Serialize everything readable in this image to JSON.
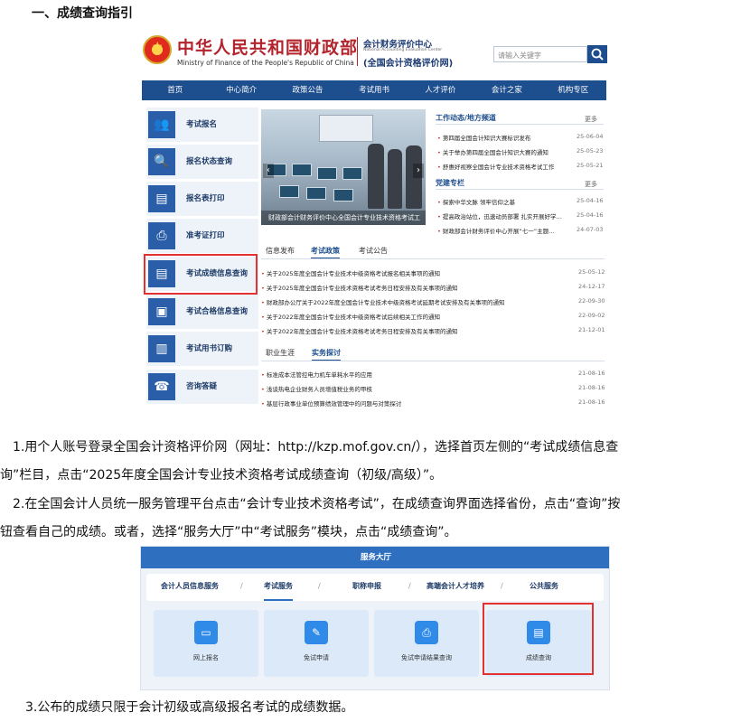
{
  "heading": "一、成绩查询指引",
  "shot1": {
    "ministry_cn": "中华人民共和国财政部",
    "ministry_en": "Ministry of Finance of the People's Republic of China",
    "center_cn": "会计财务评价中心",
    "center_en": "National Accounting Evaluation Center",
    "center_sub": "(全国会计资格评价网)",
    "search_placeholder": "请输入关键字",
    "nav": [
      "首页",
      "中心简介",
      "政策公告",
      "考试用书",
      "人才评价",
      "会计之家",
      "机构专区"
    ],
    "sidebar": [
      {
        "label": "考试报名",
        "icon": "users-icon"
      },
      {
        "label": "报名状态查询",
        "icon": "search-doc-icon"
      },
      {
        "label": "报名表打印",
        "icon": "form-print-icon"
      },
      {
        "label": "准考证打印",
        "icon": "printer-icon"
      },
      {
        "label": "考试成绩信息查询",
        "icon": "score-icon"
      },
      {
        "label": "考试合格信息查询",
        "icon": "certificate-icon"
      },
      {
        "label": "考试用书订购",
        "icon": "book-icon"
      },
      {
        "label": "咨询答疑",
        "icon": "support-icon"
      }
    ],
    "photo_caption": "财政部会计财务评价中心全国会计专业技术资格考试工作",
    "work_news": {
      "title": "工作动态/地方频道",
      "more": "更多",
      "items": [
        {
          "text": "第四届全国会计知识大赛标识发布",
          "date": "25-06-04"
        },
        {
          "text": "关于举办第四届全国会计知识大赛的通知",
          "date": "25-05-23"
        },
        {
          "text": "舒惠好视察全国会计专业技术资格考试工作",
          "date": "25-05-21"
        }
      ]
    },
    "party": {
      "title": "党建专栏",
      "more": "更多",
      "items": [
        {
          "text": "探索中华文脉  领牢信仰之基",
          "date": "25-04-16"
        },
        {
          "text": "提高政治站位，迅速动员部署 扎实开展好学…",
          "date": "25-04-16"
        },
        {
          "text": "财政部会计财务评价中心开展“七一”主题…",
          "date": "24-07-03"
        }
      ]
    },
    "tabs1": [
      "信息发布",
      "考试政策",
      "考试公告"
    ],
    "list1": [
      {
        "text": "关于2025年度全国会计专业技术中级资格考试报名相关事项的通知",
        "date": "25-05-12"
      },
      {
        "text": "关于2025年度全国会计专业技术资格考试考务日程安排及有关事项的通知",
        "date": "24-12-17"
      },
      {
        "text": "财政部办公厅关于2022年度全国会计专业技术中级资格考试延期考试安排及有关事项的通知",
        "date": "22-09-30"
      },
      {
        "text": "关于2022年度全国会计专业技术中级资格考试后续相关工作的通知",
        "date": "22-09-02"
      },
      {
        "text": "关于2022年度全国会计专业技术资格考试考务日程安排及有关事项的通知",
        "date": "21-12-01"
      }
    ],
    "tabs2": [
      "职业生涯",
      "实务探讨"
    ],
    "list2": [
      {
        "text": "标准成本法管控电力机车单耗水平的应用",
        "date": "21-08-16"
      },
      {
        "text": "浅谈热电企业财务人员增值税业务的甲核",
        "date": "21-08-16"
      },
      {
        "text": "基层行政事业单位预算绩效管理中的问题与对策探讨",
        "date": "21-08-16"
      }
    ]
  },
  "para1_line1": "1.用个人账号登录全国会计资格评价网（网址：http://kzp.mof.gov.cn/），选择首页左侧的“考试成绩信息查",
  "para1_line2": "询”栏目，点击“2025年度全国会计专业技术资格考试成绩查询（初级/高级）”。",
  "para2_line1": "2.在全国会计人员统一服务管理平台点击“会计专业技术资格考试”，在成绩查询界面选择省份，点击“查询”按",
  "para2_line2": "钮查看自己的成绩。或者，选择“服务大厅”中“考试服务”模块，点击“成绩查询”。",
  "shot2": {
    "title": "服务大厅",
    "tabs": [
      "会计人员信息服务",
      "考试服务",
      "职称申报",
      "高端会计人才培养",
      "公共服务"
    ],
    "cards": [
      {
        "label": "网上报名",
        "icon": "signup-icon"
      },
      {
        "label": "免试申请",
        "icon": "edit-icon"
      },
      {
        "label": "免试申请结果查询",
        "icon": "result-icon"
      },
      {
        "label": "成绩查询",
        "icon": "score-query-icon"
      }
    ]
  },
  "para3": "3.公布的成绩只限于会计初级或高级报名考试的成绩数据。",
  "colors": {
    "brand_red": "#b3242d",
    "nav_blue": "#1d4e8d",
    "highlight_red": "#e43030",
    "service_blue": "#2f6fc0"
  }
}
